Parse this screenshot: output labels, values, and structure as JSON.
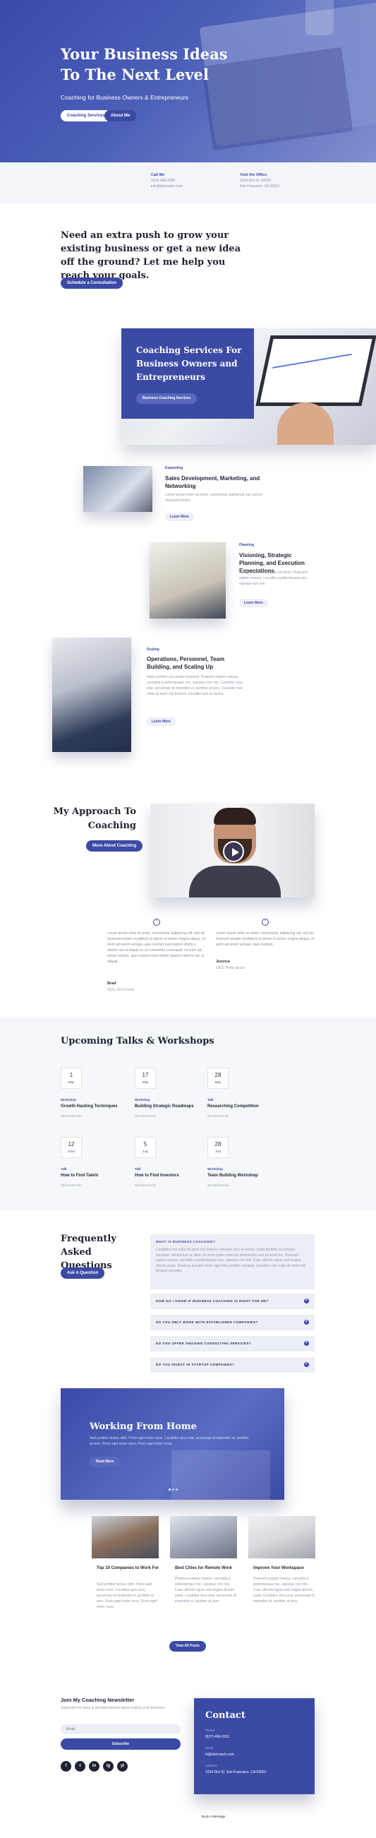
{
  "hero": {
    "title": "Your Business Ideas To The Next Level",
    "subtitle": "Coaching for Business Owners & Entrepreneurs",
    "btn_services": "Coaching Services",
    "btn_about": "About Me"
  },
  "contact_strip": {
    "call_heading": "Call Me",
    "phone": "(414) 466-2555",
    "email": "info@divicoach.com",
    "visit_heading": "Visit the Office",
    "address1": "1234 Divi St. #1000",
    "address2": "San Francisco, CA 93321"
  },
  "push": {
    "title": "Need an extra push to grow your existing business or get a new idea off the ground? Let me help you reach your goals.",
    "button": "Schedule a Consultation"
  },
  "services_feature": {
    "title": "Coaching Services For Business Owners and Entrepreneurs",
    "button": "Business Coaching Services"
  },
  "services": [
    {
      "tag": "Expanding",
      "title": "Sales Development, Marketing, and Networking",
      "text": "Lorem ipsum dolor sit amet, consectetur adipiscing elit, sed do eiusmod tempor.",
      "link": "Learn More"
    },
    {
      "tag": "Planning",
      "title": "Visioning, Strategic Planning, and Execution Expectations",
      "text": "Nulla porttitor accumsan tincidunt. Praesent sapien massa, convallis a pellentesque nec, egestas non nisi.",
      "link": "Learn More"
    },
    {
      "tag": "Scaling",
      "title": "Operations, Personnel, Team Building, and Scaling Up",
      "text": "Nulla porttitor accumsan tincidunt. Praesent sapien massa, convallis a pellentesque nec, egestas non nisi. Curabitur arcu erat, accumsan id imperdiet et, porttitor at sem. Curabitur non nulla sit amet nisl tempus convallis quis ac lectus.",
      "link": "Learn More"
    }
  ],
  "approach": {
    "title": "My Approach To Coaching",
    "button": "More About Coaching"
  },
  "testimonials": [
    {
      "text": "Lorem ipsum dolor sit amet, consectetur adipiscing elit, sed do eiusmod tempor incididunt ut labore et dolore magna aliqua. Ut enim ad minim veniam, quis nostrud exercitation ullamco laboris nisi ut aliquip ex ea commodo consequat. Ut enim ad minim veniam, quis nostrud exercitation ullamco laboris nisi ut aliquip.",
      "name": "Brad",
      "role": "CEO, Divi Corner"
    },
    {
      "text": "Lorem ipsum dolor sit amet, consectetur adipiscing elit, sed do eiusmod tempor incididunt ut labore et dolore magna aliqua. Ut enim ad minim veniam, quis nostrud.",
      "name": "Jessica",
      "role": "CEO, Petra Space"
    }
  ],
  "talks": {
    "title": "Upcoming Talks & Workshops",
    "events": [
      {
        "day": "1",
        "month": "May",
        "tag": "Workshop",
        "title": "Growth Hacking Techniques",
        "link": "See Event Info"
      },
      {
        "day": "17",
        "month": "May",
        "tag": "Workshop",
        "title": "Building Strategic Roadmaps",
        "link": "See Event Info"
      },
      {
        "day": "28",
        "month": "May",
        "tag": "Talk",
        "title": "Researching Competition",
        "link": "See Event Info"
      },
      {
        "day": "12",
        "month": "June",
        "tag": "Talk",
        "title": "How to Find Talent",
        "link": "See Event Info"
      },
      {
        "day": "5",
        "month": "July",
        "tag": "Talk",
        "title": "How to Find Investors",
        "link": "See Event Info"
      },
      {
        "day": "28",
        "month": "July",
        "tag": "Workshop",
        "title": "Team Building Workshop",
        "link": "See Event Info"
      }
    ]
  },
  "faq": {
    "title": "Frequently Asked Questions",
    "button": "Ask A Question",
    "open_question": "WHAT IS BUSINESS COACHING?",
    "open_answer": "Curabitur non nulla sit amet nisl tempus convallis quis ac lectus. Nulla porttitor accumsan tincidunt. Vestibulum ac diam sit amet quam vehicula elementum sed sit amet dui. Praesent sapien massa, convallis a pellentesque nec, egestas non nisi. Cras ultricies ligula sed magna dictum porta. Vivamus suscipit tortor eget felis porttitor volutpat. Curabitur non nulla sit amet nisl tempus convallis.",
    "questions": [
      "HOW DO I KNOW IF BUSINESS COACHING IS RIGHT FOR ME?",
      "DO YOU ONLY WORK WITH ESTABLISHED COMPANIES?",
      "DO YOU OFFER ONGOING CONSULTING SERVICES?",
      "DO YOU INVEST IN STARTUP COMPANIES?"
    ]
  },
  "slider": {
    "title": "Working From Home",
    "text": "Sed porttitor lectus nibh. Proin eget tortor risus. Curabitur arcu erat, accumsan id imperdiet et, porttitor at sem. Proin eget tortor risus. Proin eget tortor risus.",
    "button": "Read More"
  },
  "blog": [
    {
      "title": "Top 10 Companies to Work For",
      "text": "Sed porttitor lectus nibh. Proin eget tortor risus. Curabitur arcu erat, accumsan id imperdiet et, porttitor at sem. Proin eget tortor risus. Proin eget tortor risus."
    },
    {
      "title": "Best Cities for Remote Work",
      "text": "Praesent sapien massa, convallis a pellentesque nec, egestas non nisi. Cras ultricies ligula sed magna dictum porta. Curabitur arcu erat, accumsan id imperdiet et, porttitor at sem."
    },
    {
      "title": "Improve Your Workspace",
      "text": "Praesent sapien massa, convallis a pellentesque nec, egestas non nisi. Cras ultricies ligula sed magna dictum porta. Curabitur arcu erat, accumsan id imperdiet et, porttitor at sem."
    }
  ],
  "blog_button": "View All Posts",
  "newsletter": {
    "title": "Join My Coaching Newsletter",
    "subtitle": "Subscribe for news & announcements about scaling your business",
    "email_placeholder": "Email",
    "button": "Subscribe",
    "social": [
      "f",
      "t",
      "in",
      "ig",
      "yt"
    ]
  },
  "contact": {
    "title": "Contact",
    "phone_label": "Phone",
    "phone": "(527) 466-9151",
    "email_label": "Email",
    "email": "hi@divicoach.com",
    "address_label": "Address",
    "address": "1234 Divi St. San Francisco, CA 93921"
  },
  "footer_link": "Book A Message",
  "colors": {
    "accent": "#3b4aa5",
    "light_bg": "#f4f5fa"
  }
}
